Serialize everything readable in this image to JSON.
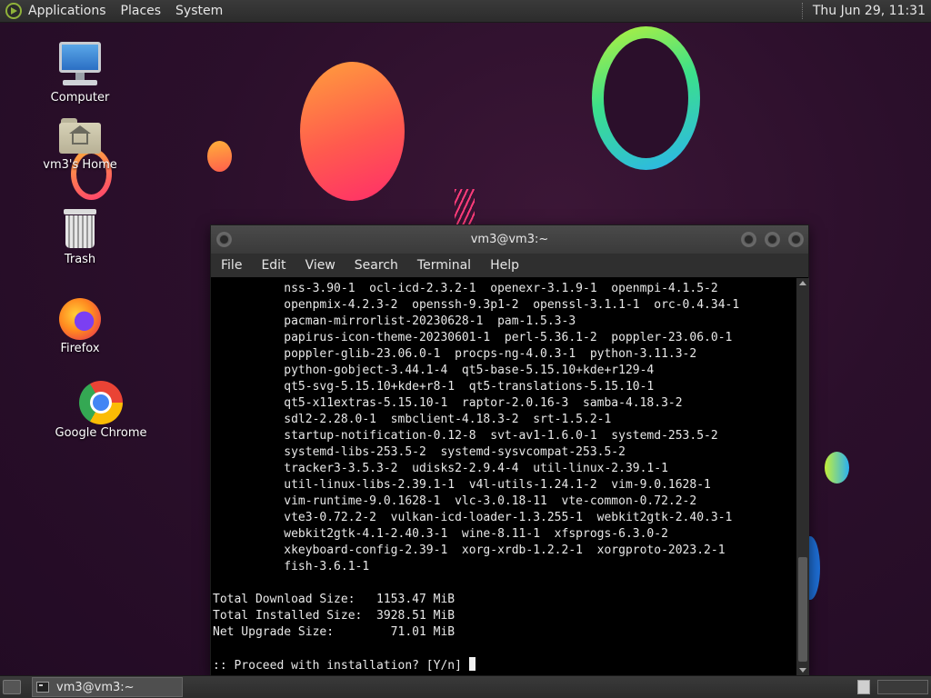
{
  "top_panel": {
    "menus": [
      "Applications",
      "Places",
      "System"
    ],
    "clock": "Thu Jun 29, 11:31"
  },
  "desktop_icons": {
    "computer": "Computer",
    "home": "vm3's Home",
    "trash": "Trash",
    "firefox": "Firefox",
    "chrome": "Google Chrome"
  },
  "terminal": {
    "title": "vm3@vm3:~",
    "menu": [
      "File",
      "Edit",
      "View",
      "Search",
      "Terminal",
      "Help"
    ],
    "lines": [
      "          nss-3.90-1  ocl-icd-2.3.2-1  openexr-3.1.9-1  openmpi-4.1.5-2",
      "          openpmix-4.2.3-2  openssh-9.3p1-2  openssl-3.1.1-1  orc-0.4.34-1",
      "          pacman-mirrorlist-20230628-1  pam-1.5.3-3",
      "          papirus-icon-theme-20230601-1  perl-5.36.1-2  poppler-23.06.0-1",
      "          poppler-glib-23.06.0-1  procps-ng-4.0.3-1  python-3.11.3-2",
      "          python-gobject-3.44.1-4  qt5-base-5.15.10+kde+r129-4",
      "          qt5-svg-5.15.10+kde+r8-1  qt5-translations-5.15.10-1",
      "          qt5-x11extras-5.15.10-1  raptor-2.0.16-3  samba-4.18.3-2",
      "          sdl2-2.28.0-1  smbclient-4.18.3-2  srt-1.5.2-1",
      "          startup-notification-0.12-8  svt-av1-1.6.0-1  systemd-253.5-2",
      "          systemd-libs-253.5-2  systemd-sysvcompat-253.5-2",
      "          tracker3-3.5.3-2  udisks2-2.9.4-4  util-linux-2.39.1-1",
      "          util-linux-libs-2.39.1-1  v4l-utils-1.24.1-2  vim-9.0.1628-1",
      "          vim-runtime-9.0.1628-1  vlc-3.0.18-11  vte-common-0.72.2-2",
      "          vte3-0.72.2-2  vulkan-icd-loader-1.3.255-1  webkit2gtk-2.40.3-1",
      "          webkit2gtk-4.1-2.40.3-1  wine-8.11-1  xfsprogs-6.3.0-2",
      "          xkeyboard-config-2.39-1  xorg-xrdb-1.2.2-1  xorgproto-2023.2-1",
      "          fish-3.6.1-1",
      "",
      "Total Download Size:   1153.47 MiB",
      "Total Installed Size:  3928.51 MiB",
      "Net Upgrade Size:        71.01 MiB",
      ""
    ],
    "prompt": ":: Proceed with installation? [Y/n] "
  },
  "taskbar": {
    "task_label": "vm3@vm3:~"
  }
}
